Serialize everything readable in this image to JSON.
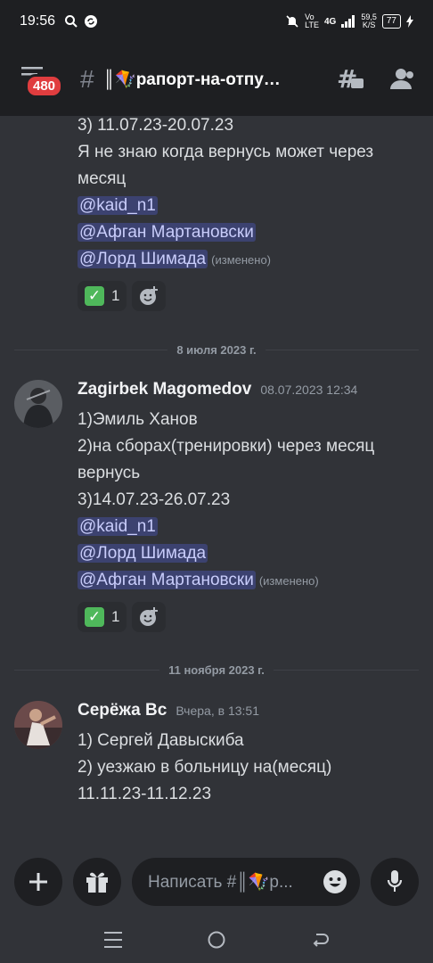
{
  "status": {
    "time": "19:56",
    "net_label_1": "Vo",
    "net_label_2": "LTE",
    "net_gen": "4G",
    "speed": "59,5",
    "speed_unit": "K/S",
    "battery": "77"
  },
  "header": {
    "badge": "480",
    "channel": "║🪁рапорт-на-отпу…"
  },
  "messages": [
    {
      "lines": [
        "3) 11.07.23-20.07.23",
        "Я не знаю когда вернусь может через",
        "месяц"
      ],
      "mentions": [
        "@kaid_n1",
        "@Афган Мартановски",
        "@Лорд Шимада"
      ],
      "edited": "(изменено)",
      "reaction": {
        "emoji": "✅",
        "count": "1"
      }
    },
    {
      "author": "Zagirbek Magomedov",
      "timestamp": "08.07.2023 12:34",
      "lines": [
        "1)Эмиль Ханов",
        "2)на сборах(тренировки) через месяц",
        "вернусь",
        "3)14.07.23-26.07.23"
      ],
      "mentions": [
        "@kaid_n1",
        "@Лорд Шимада",
        "@Афган Мартановски"
      ],
      "edited": "(изменено)",
      "reaction": {
        "emoji": "✅",
        "count": "1"
      }
    },
    {
      "author": "Серёжа Вс",
      "timestamp": "Вчера, в 13:51",
      "lines": [
        "1) Сергей Давыскиба",
        "2) уезжаю в больницу на(месяц)",
        "11.11.23-11.12.23"
      ]
    }
  ],
  "dividers": [
    "8 июля 2023 г.",
    "11 ноября 2023 г."
  ],
  "input": {
    "placeholder": "Написать #║🪁р..."
  },
  "icons": [
    "hamburger-icon",
    "hash-icon",
    "threads-icon",
    "members-icon",
    "plus-icon",
    "gift-icon",
    "emoji-icon",
    "mic-icon",
    "add-reaction-icon",
    "nav-menu-icon",
    "nav-home-icon",
    "nav-back-icon"
  ],
  "colors": {
    "background": "#313338",
    "header": "#1e1f22",
    "mention_bg": "#3c4270",
    "mention_text": "#c9cdfb",
    "badge": "#e03d3f"
  }
}
